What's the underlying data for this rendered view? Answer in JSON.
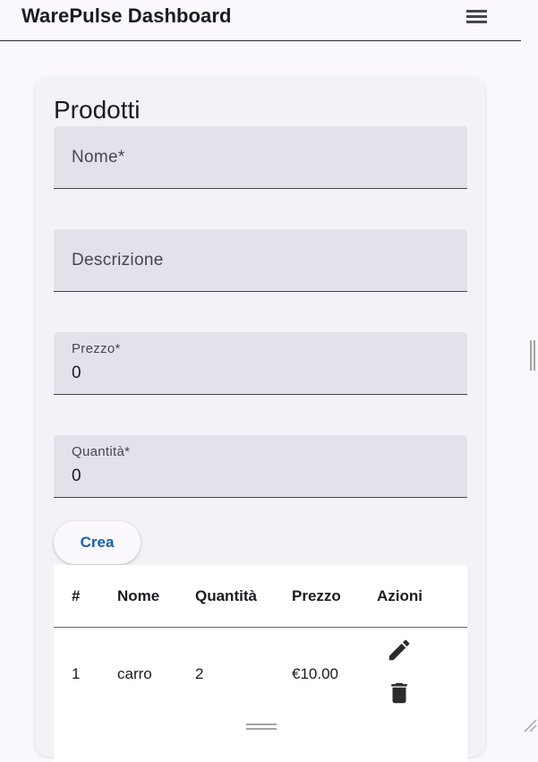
{
  "header": {
    "title": "WarePulse Dashboard",
    "menu_icon": "hamburger-menu-icon"
  },
  "card": {
    "title": "Prodotti"
  },
  "form": {
    "nome": {
      "label": "Nome*",
      "value": ""
    },
    "descrizione": {
      "label": "Descrizione",
      "value": ""
    },
    "prezzo": {
      "label": "Prezzo*",
      "value": "0"
    },
    "quantita": {
      "label": "Quantità*",
      "value": "0"
    },
    "create_label": "Crea"
  },
  "table": {
    "columns": [
      "#",
      "Nome",
      "Quantità",
      "Prezzo",
      "Azioni"
    ],
    "rows": [
      {
        "index": "1",
        "nome": "carro",
        "quantita": "2",
        "prezzo": "€10.00",
        "actions": [
          "edit-icon",
          "delete-icon"
        ]
      }
    ]
  },
  "colors": {
    "accent": "#1a5fad",
    "field_bg": "#e2e2ea",
    "page_bg": "#faf8fd",
    "card_bg": "#f3f3f7"
  }
}
